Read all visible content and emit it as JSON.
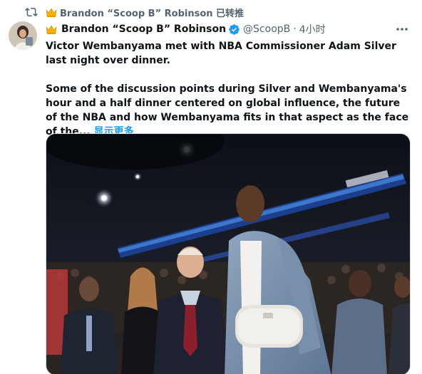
{
  "retweet": {
    "icon": "retweet-icon",
    "crown_icon": "crown-icon",
    "label": "Brandon “Scoop B” Robinson 已转推"
  },
  "tweet": {
    "author": {
      "display_name": "Brandon “Scoop B” Robinson",
      "handle": "@ScoopB",
      "separator": "·",
      "time": "4小时",
      "verified": true
    },
    "text": {
      "paragraph1": "Victor Wembanyama met with NBA Commissioner Adam Silver last night over dinner.",
      "paragraph2": "Some of the discussion points during Silver and Wembanyama's hour and a half dinner centered on global influence, the future of the NBA and how Wembanyama fits in that aspect as the face of the...",
      "show_more": "显示更多"
    },
    "more_icon": "more-horizontal-icon"
  },
  "colors": {
    "accent": "#1d9bf0",
    "secondary_text": "#536471",
    "primary_text": "#0f1419"
  }
}
